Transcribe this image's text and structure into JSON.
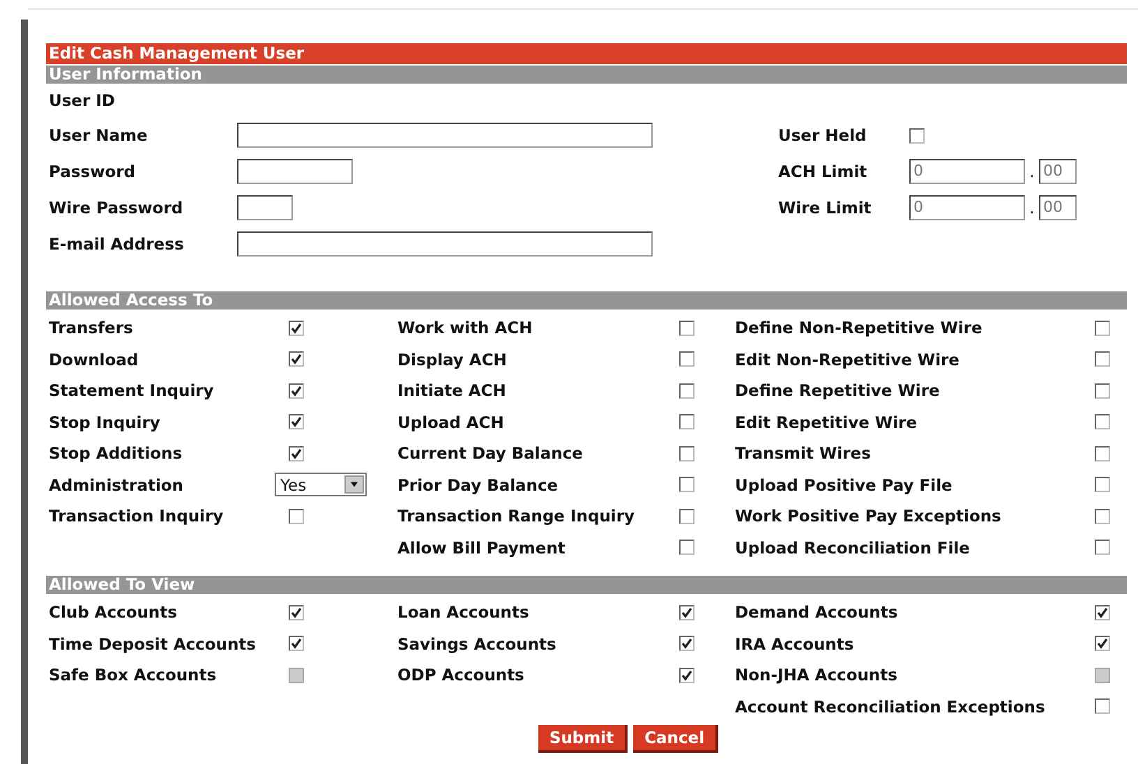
{
  "title": "Edit Cash Management User",
  "user_information": {
    "heading": "User Information",
    "user_id": {
      "label": "User ID"
    },
    "fields": [
      {
        "label": "User Name",
        "kind": "long"
      },
      {
        "label": "Password",
        "kind": "medium"
      },
      {
        "label": "Wire Password",
        "kind": "short"
      },
      {
        "label": "E-mail Address",
        "kind": "long"
      }
    ],
    "right": [
      {
        "kind": "checkbox",
        "label": "User Held",
        "checked": false
      },
      {
        "kind": "amount",
        "label": "ACH Limit",
        "whole": "0",
        "separator": ".",
        "cents": "00"
      },
      {
        "kind": "amount",
        "label": "Wire Limit",
        "whole": "0",
        "separator": ".",
        "cents": "00"
      }
    ]
  },
  "allowed_access": {
    "heading": "Allowed Access To",
    "columns": [
      [
        {
          "kind": "checkbox",
          "label": "Transfers",
          "checked": true
        },
        {
          "kind": "checkbox",
          "label": "Download",
          "checked": true
        },
        {
          "kind": "checkbox",
          "label": "Statement Inquiry",
          "checked": true
        },
        {
          "kind": "checkbox",
          "label": "Stop Inquiry",
          "checked": true
        },
        {
          "kind": "checkbox",
          "label": "Stop Additions",
          "checked": true
        },
        {
          "kind": "select",
          "label": "Administration",
          "value": "Yes"
        },
        {
          "kind": "checkbox",
          "label": "Transaction Inquiry",
          "checked": false
        }
      ],
      [
        {
          "kind": "checkbox",
          "label": "Work with ACH",
          "checked": false
        },
        {
          "kind": "checkbox",
          "label": "Display ACH",
          "checked": false
        },
        {
          "kind": "checkbox",
          "label": "Initiate ACH",
          "checked": false
        },
        {
          "kind": "checkbox",
          "label": "Upload ACH",
          "checked": false
        },
        {
          "kind": "checkbox",
          "label": "Current Day Balance",
          "checked": false
        },
        {
          "kind": "checkbox",
          "label": "Prior Day Balance",
          "checked": false
        },
        {
          "kind": "checkbox",
          "label": "Transaction Range Inquiry",
          "checked": false
        },
        {
          "kind": "checkbox",
          "label": "Allow Bill Payment",
          "checked": false
        }
      ],
      [
        {
          "kind": "checkbox",
          "label": "Define Non-Repetitive Wire",
          "checked": false
        },
        {
          "kind": "checkbox",
          "label": "Edit Non-Repetitive Wire",
          "checked": false
        },
        {
          "kind": "checkbox",
          "label": "Define Repetitive Wire",
          "checked": false
        },
        {
          "kind": "checkbox",
          "label": "Edit Repetitive Wire",
          "checked": false
        },
        {
          "kind": "checkbox",
          "label": "Transmit Wires",
          "checked": false
        },
        {
          "kind": "checkbox",
          "label": "Upload Positive Pay File",
          "checked": false
        },
        {
          "kind": "checkbox",
          "label": "Work Positive Pay Exceptions",
          "checked": false
        },
        {
          "kind": "checkbox",
          "label": "Upload Reconciliation File",
          "checked": false
        }
      ]
    ]
  },
  "allowed_to_view": {
    "heading": "Allowed To View",
    "columns": [
      [
        {
          "kind": "checkbox",
          "label": "Club Accounts",
          "checked": true,
          "disabled": false
        },
        {
          "kind": "checkbox",
          "label": "Time Deposit Accounts",
          "checked": true,
          "disabled": false
        },
        {
          "kind": "checkbox",
          "label": "Safe Box Accounts",
          "checked": false,
          "disabled": true
        }
      ],
      [
        {
          "kind": "checkbox",
          "label": "Loan Accounts",
          "checked": true,
          "disabled": false
        },
        {
          "kind": "checkbox",
          "label": "Savings Accounts",
          "checked": true,
          "disabled": false
        },
        {
          "kind": "checkbox",
          "label": "ODP Accounts",
          "checked": true,
          "disabled": false
        }
      ],
      [
        {
          "kind": "checkbox",
          "label": "Demand Accounts",
          "checked": true,
          "disabled": false
        },
        {
          "kind": "checkbox",
          "label": "IRA Accounts",
          "checked": true,
          "disabled": false
        },
        {
          "kind": "checkbox",
          "label": "Non-JHA Accounts",
          "checked": false,
          "disabled": true
        },
        {
          "kind": "checkbox",
          "label": "Account Reconciliation Exceptions",
          "checked": false,
          "disabled": false
        }
      ]
    ]
  },
  "buttons": [
    "Submit",
    "Cancel"
  ]
}
